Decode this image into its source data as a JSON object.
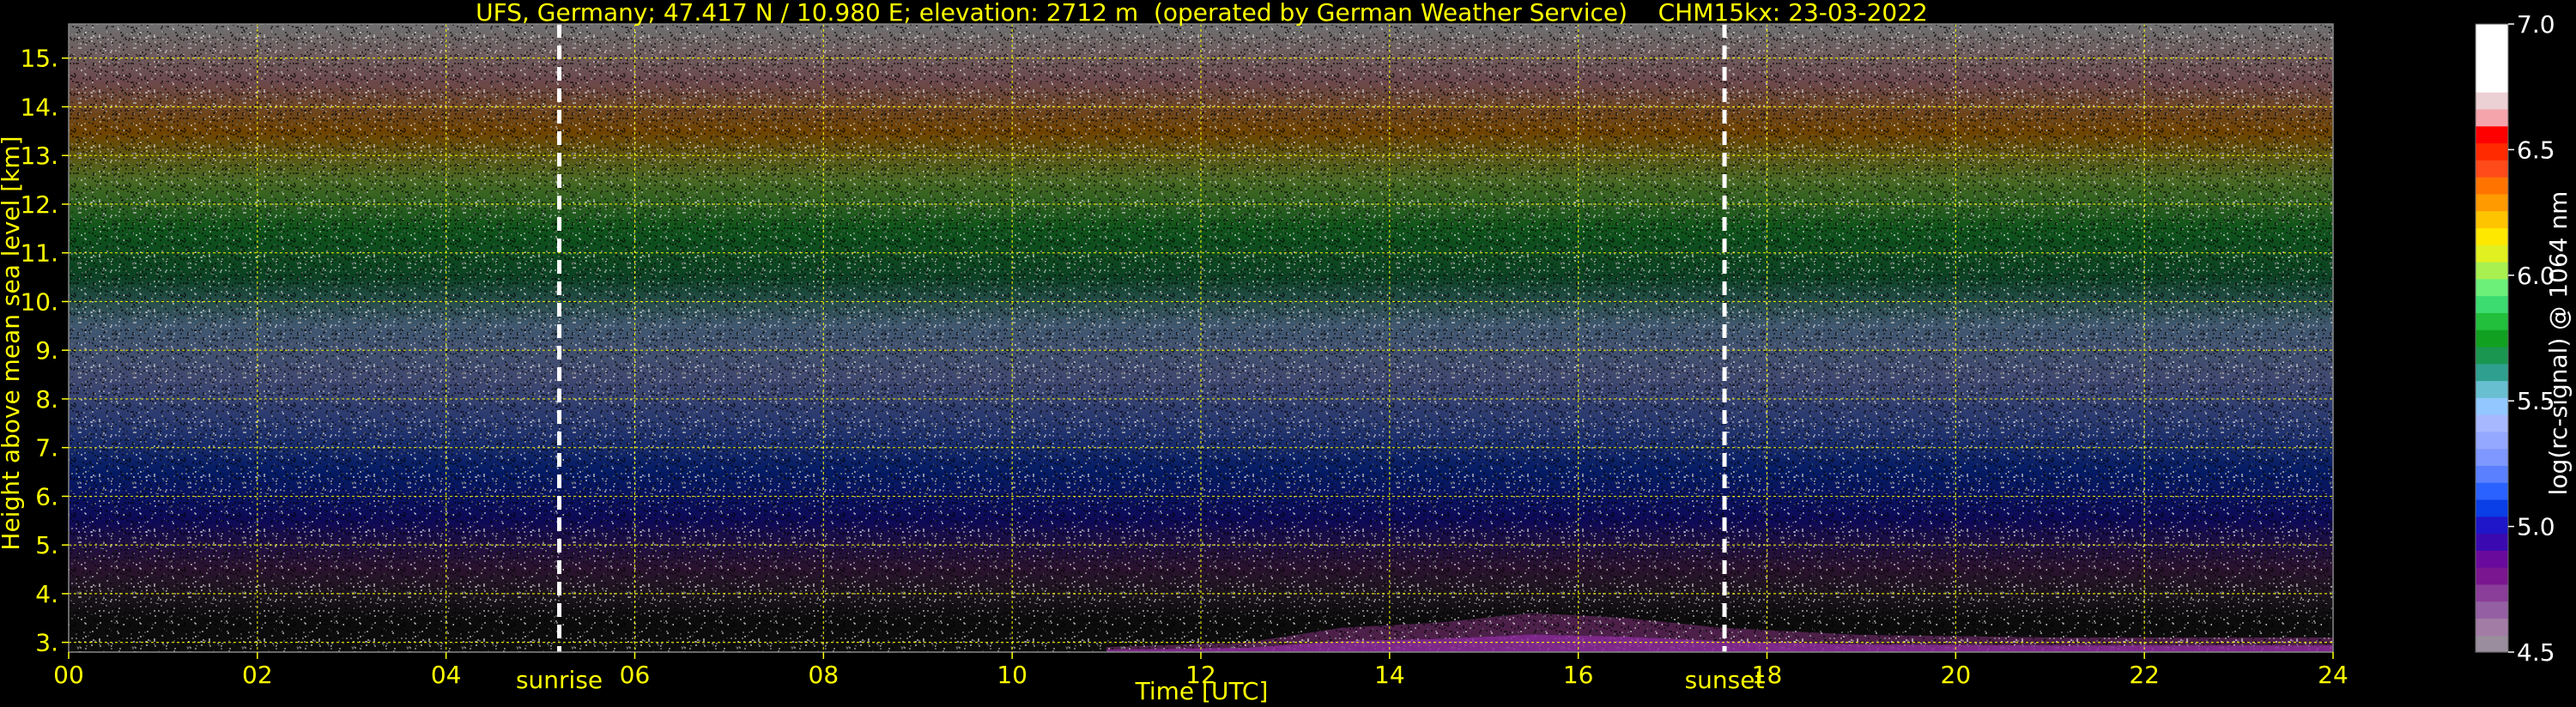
{
  "chart_data": {
    "type": "heatmap",
    "title": "UFS, Germany; 47.417 N / 10.980 E; elevation: 2712 m  (operated by German Weather Service)    CHM15kx: 23-03-2022",
    "xlabel": "Time [UTC]",
    "ylabel": "Height above mean sea level [km]",
    "xlim": [
      0,
      24
    ],
    "ylim": [
      2.8,
      15.7
    ],
    "xticks": [
      "00",
      "02",
      "04",
      "06",
      "08",
      "10",
      "12",
      "14",
      "16",
      "18",
      "20",
      "22",
      "24"
    ],
    "xtick_values": [
      0,
      2,
      4,
      6,
      8,
      10,
      12,
      14,
      16,
      18,
      20,
      22,
      24
    ],
    "yticks": [
      "3.",
      "4.",
      "5.",
      "6.",
      "7.",
      "8.",
      "9.",
      "10.",
      "11.",
      "12.",
      "13.",
      "14.",
      "15."
    ],
    "ytick_values": [
      3,
      4,
      5,
      6,
      7,
      8,
      9,
      10,
      11,
      12,
      13,
      14,
      15
    ],
    "grid": true,
    "annotations": [
      {
        "text": "sunrise",
        "x": 5.2
      },
      {
        "text": "sunset",
        "x": 17.55
      }
    ],
    "boundary_layer": [
      {
        "x": 11.0,
        "top": 2.9
      },
      {
        "x": 12.5,
        "top": 3.0
      },
      {
        "x": 13.5,
        "top": 3.3
      },
      {
        "x": 14.5,
        "top": 3.4
      },
      {
        "x": 15.5,
        "top": 3.6
      },
      {
        "x": 16.5,
        "top": 3.5
      },
      {
        "x": 17.5,
        "top": 3.3
      },
      {
        "x": 19.0,
        "top": 3.15
      },
      {
        "x": 21.0,
        "top": 3.1
      },
      {
        "x": 24.0,
        "top": 3.1
      }
    ],
    "colorbar": {
      "label": "log(rc-signal) @ 1064 nm",
      "min": 4.5,
      "max": 7.0,
      "ticks": [
        "7.0",
        "6.5",
        "6.0",
        "5.5",
        "5.0",
        "4.5"
      ],
      "tick_values": [
        7.0,
        6.5,
        6.0,
        5.5,
        5.0,
        4.5
      ],
      "colors": [
        "#9a8d9d",
        "#a37ca6",
        "#9560a3",
        "#8a3d99",
        "#7a168f",
        "#6a0a9c",
        "#3a0ab0",
        "#1e16c8",
        "#0a3ee6",
        "#2a62ff",
        "#5a80ff",
        "#7e98ff",
        "#95a8ff",
        "#a8b8ff",
        "#92c8ff",
        "#67bfd0",
        "#2fa08f",
        "#1a9650",
        "#12a020",
        "#22bf3c",
        "#3cdc70",
        "#6cf07a",
        "#a8f050",
        "#e0f020",
        "#ffe800",
        "#ffc400",
        "#ff9a00",
        "#ff7400",
        "#ff4a1a",
        "#ff2a00",
        "#ff0000",
        "#f5a4ac",
        "#ebd0d4",
        "#ffffff",
        "#ffffff",
        "#ffffff",
        "#ffffff"
      ]
    },
    "signal_profile": [
      {
        "height": 2.8,
        "value": 4.5
      },
      {
        "height": 3.5,
        "value": 4.55
      },
      {
        "height": 4.5,
        "value": 4.75
      },
      {
        "height": 5.5,
        "value": 5.0
      },
      {
        "height": 6.5,
        "value": 5.1
      },
      {
        "height": 7.5,
        "value": 5.2
      },
      {
        "height": 8.5,
        "value": 5.35
      },
      {
        "height": 9.5,
        "value": 5.5
      },
      {
        "height": 10.5,
        "value": 5.65
      },
      {
        "height": 11.5,
        "value": 5.8
      },
      {
        "height": 12.5,
        "value": 6.0
      },
      {
        "height": 13.5,
        "value": 6.3
      },
      {
        "height": 14.5,
        "value": 6.6
      },
      {
        "height": 15.7,
        "value": 6.9
      }
    ]
  }
}
